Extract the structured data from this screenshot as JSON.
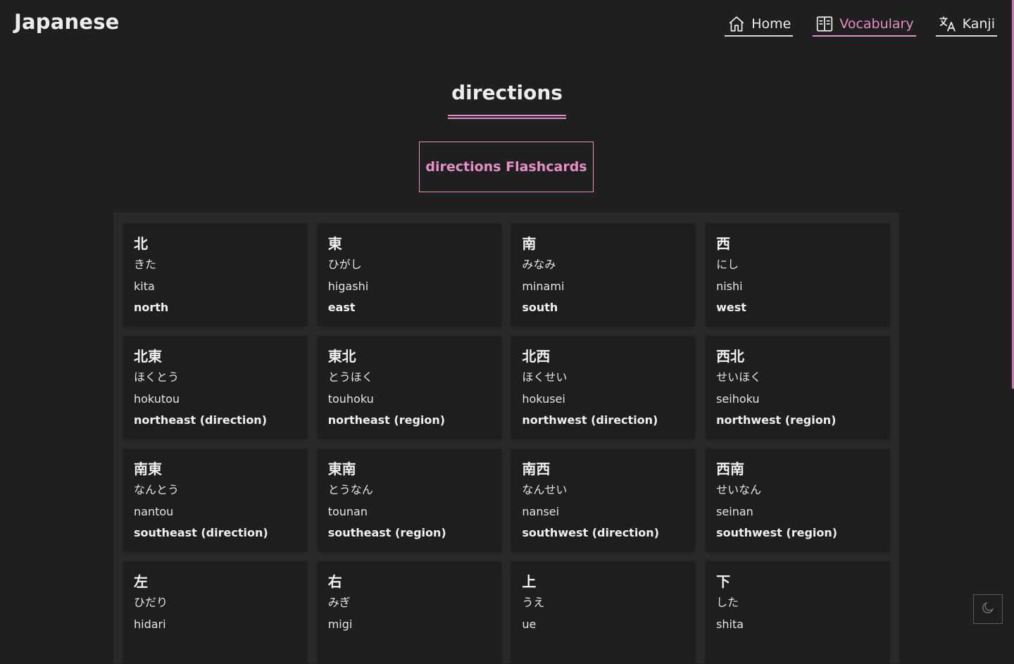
{
  "brand": "Japanese",
  "nav": [
    {
      "label": "Home",
      "icon": "home-icon",
      "active": false
    },
    {
      "label": "Vocabulary",
      "icon": "book-icon",
      "active": true
    },
    {
      "label": "Kanji",
      "icon": "translate-icon",
      "active": false
    }
  ],
  "page": {
    "title": "directions",
    "flashcards_label": "directions Flashcards"
  },
  "accent_color": "#e58fc6",
  "background_color": "#201f20",
  "cards": [
    {
      "kanji": "北",
      "kana": "きた",
      "romaji": "kita",
      "meaning": "north"
    },
    {
      "kanji": "東",
      "kana": "ひがし",
      "romaji": "higashi",
      "meaning": "east"
    },
    {
      "kanji": "南",
      "kana": "みなみ",
      "romaji": "minami",
      "meaning": "south"
    },
    {
      "kanji": "西",
      "kana": "にし",
      "romaji": "nishi",
      "meaning": "west"
    },
    {
      "kanji": "北東",
      "kana": "ほくとう",
      "romaji": "hokutou",
      "meaning": "northeast (direction)"
    },
    {
      "kanji": "東北",
      "kana": "とうほく",
      "romaji": "touhoku",
      "meaning": "northeast (region)"
    },
    {
      "kanji": "北西",
      "kana": "ほくせい",
      "romaji": "hokusei",
      "meaning": "northwest (direction)"
    },
    {
      "kanji": "西北",
      "kana": "せいほく",
      "romaji": "seihoku",
      "meaning": "northwest (region)"
    },
    {
      "kanji": "南東",
      "kana": "なんとう",
      "romaji": "nantou",
      "meaning": "southeast (direction)"
    },
    {
      "kanji": "東南",
      "kana": "とうなん",
      "romaji": "tounan",
      "meaning": "southeast (region)"
    },
    {
      "kanji": "南西",
      "kana": "なんせい",
      "romaji": "nansei",
      "meaning": "southwest (direction)"
    },
    {
      "kanji": "西南",
      "kana": "せいなん",
      "romaji": "seinan",
      "meaning": "southwest (region)"
    },
    {
      "kanji": "左",
      "kana": "ひだり",
      "romaji": "hidari",
      "meaning": ""
    },
    {
      "kanji": "右",
      "kana": "みぎ",
      "romaji": "migi",
      "meaning": ""
    },
    {
      "kanji": "上",
      "kana": "うえ",
      "romaji": "ue",
      "meaning": ""
    },
    {
      "kanji": "下",
      "kana": "した",
      "romaji": "shita",
      "meaning": ""
    }
  ],
  "theme_toggle_icon": "moon-icon"
}
